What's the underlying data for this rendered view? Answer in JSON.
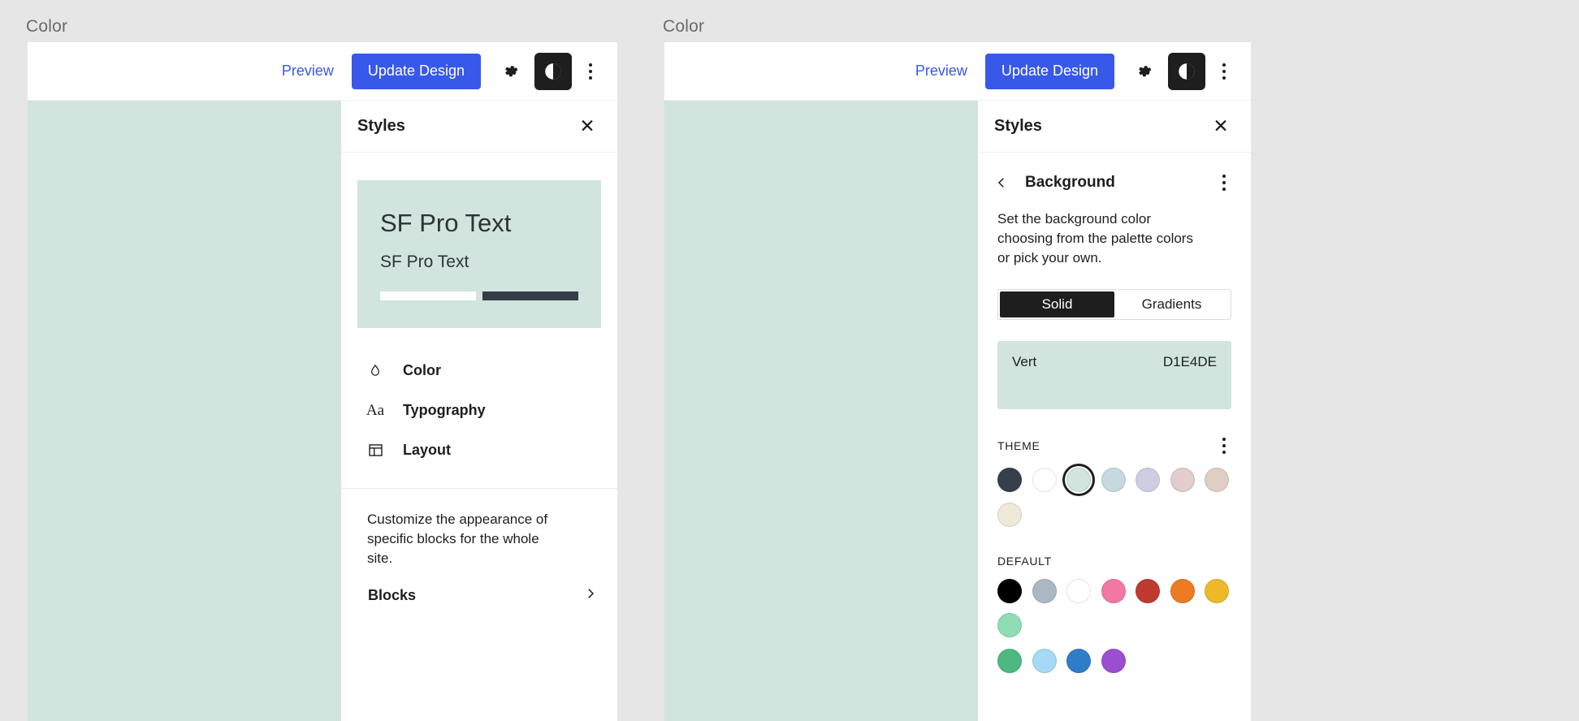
{
  "frames": [
    {
      "label": "Color"
    },
    {
      "label": "Color"
    }
  ],
  "toolbar": {
    "preview_label": "Preview",
    "update_label": "Update Design",
    "gear_icon": "gear-icon",
    "contrast_icon": "contrast-icon",
    "more_icon": "kebab-menu-icon",
    "accent_color": "#3858e9"
  },
  "styles_panel": {
    "title": "Styles",
    "close_icon": "close-icon"
  },
  "left_panel": {
    "preview_card": {
      "heading": "SF Pro Text",
      "subheading": "SF Pro Text",
      "background": "#D1E4DE",
      "bar_light_color": "#FFFFFF",
      "bar_dark_color": "#333C47"
    },
    "menu": [
      {
        "icon": "droplet-icon",
        "label": "Color"
      },
      {
        "icon": "typography-aa-icon",
        "label": "Typography"
      },
      {
        "icon": "layout-icon",
        "label": "Layout"
      }
    ],
    "blocks": {
      "description": "Customize the appearance of specific blocks for the whole site.",
      "label": "Blocks",
      "chevron_icon": "chevron-right-icon"
    }
  },
  "right_panel": {
    "back_icon": "chevron-left-icon",
    "title": "Background",
    "more_icon": "kebab-menu-icon",
    "description": "Set the background color choosing from the palette colors or pick your own.",
    "tabs": [
      {
        "label": "Solid",
        "active": true
      },
      {
        "label": "Gradients",
        "active": false
      }
    ],
    "selected_color": {
      "name": "Vert",
      "hex": "D1E4DE",
      "swatch": "#D1E4DE"
    },
    "theme_section": {
      "title": "THEME",
      "more_icon": "kebab-menu-icon",
      "swatches": [
        {
          "hex": "#37404A",
          "selected": false
        },
        {
          "hex": "#FFFFFF",
          "selected": false
        },
        {
          "hex": "#D1E4DE",
          "selected": true
        },
        {
          "hex": "#C5D9DF",
          "selected": false
        },
        {
          "hex": "#CDCDE3",
          "selected": false
        },
        {
          "hex": "#E3CCCD",
          "selected": false
        },
        {
          "hex": "#DECEC4",
          "selected": false
        },
        {
          "hex": "#EDE8D7",
          "selected": false
        }
      ]
    },
    "default_section": {
      "title": "DEFAULT",
      "swatches": [
        {
          "hex": "#000000"
        },
        {
          "hex": "#ABB8C3"
        },
        {
          "hex": "#FFFFFF"
        },
        {
          "hex": "#F078A3"
        },
        {
          "hex": "#BF3A30"
        },
        {
          "hex": "#ED7B23"
        },
        {
          "hex": "#EDB82A"
        },
        {
          "hex": "#8FDDB5"
        },
        {
          "hex": "#4AB островa"
        }
      ],
      "swatches_row2": [
        {
          "hex": "#4CB островB"
        }
      ]
    },
    "default_row1": [
      {
        "hex": "#000000"
      },
      {
        "hex": "#ABB8C3"
      },
      {
        "hex": "#FFFFFF"
      },
      {
        "hex": "#F078A3"
      },
      {
        "hex": "#BF3A30"
      },
      {
        "hex": "#ED7B23"
      },
      {
        "hex": "#EDB82A"
      },
      {
        "hex": "#8FDDB5"
      }
    ],
    "default_row2": [
      {
        "hex": "#4CB981"
      },
      {
        "hex": "#A7D8F5"
      },
      {
        "hex": "#2F7DC9"
      },
      {
        "hex": "#9B4FD0"
      }
    ]
  }
}
